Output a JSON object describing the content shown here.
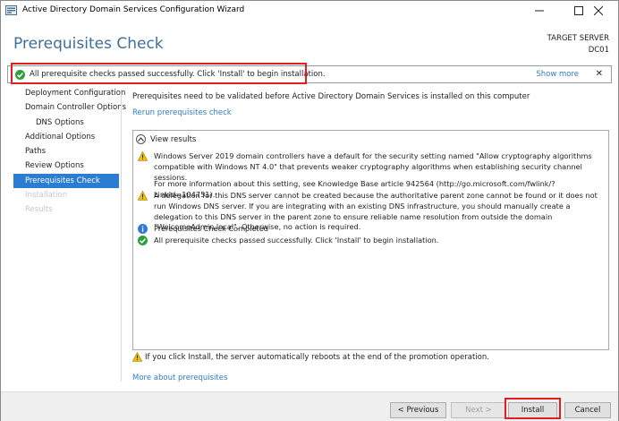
{
  "window": {
    "title": "Active Directory Domain Services Configuration Wizard",
    "controls": [
      "minimize-icon",
      "maximize-icon",
      "close-icon"
    ]
  },
  "header": {
    "title": "Prerequisites Check",
    "target_label": "TARGET SERVER",
    "target_name": "DC01"
  },
  "status": {
    "icon": "success-check-icon",
    "text": "All prerequisite checks passed successfully.  Click 'Install' to begin installation.",
    "show_more": "Show more",
    "close": "✕"
  },
  "sidebar": {
    "items": [
      {
        "label": "Deployment Configuration",
        "state": "normal"
      },
      {
        "label": "Domain Controller Options",
        "state": "normal"
      },
      {
        "label": "DNS Options",
        "state": "normal",
        "sub": true
      },
      {
        "label": "Additional Options",
        "state": "normal"
      },
      {
        "label": "Paths",
        "state": "normal"
      },
      {
        "label": "Review Options",
        "state": "normal"
      },
      {
        "label": "Prerequisites Check",
        "state": "active"
      },
      {
        "label": "Installation",
        "state": "disabled"
      },
      {
        "label": "Results",
        "state": "disabled"
      }
    ]
  },
  "main": {
    "intro": "Prerequisites need to be validated before Active Directory Domain Services is installed on this computer",
    "rerun": "Rerun prerequisites check",
    "view_results": "View results",
    "messages": [
      {
        "icon": "warning-icon",
        "text": "Windows Server 2019 domain controllers have a default for the security setting named \"Allow cryptography algorithms compatible with Windows NT 4.0\" that prevents weaker cryptography algorithms when establishing security channel sessions."
      },
      {
        "icon": "",
        "text": "For more information about this setting, see Knowledge Base article 942564 (http://go.microsoft.com/fwlink/?LinkId=104751)."
      },
      {
        "icon": "warning-icon",
        "text": "A delegation for this DNS server cannot be created because the authoritative parent zone cannot be found or it does not run Windows DNS server. If you are integrating with an existing DNS infrastructure, you should manually create a delegation to this DNS server in the parent zone to ensure reliable name resolution from outside the domain \"WelcomeAdmin.local\". Otherwise, no action is required."
      },
      {
        "icon": "info-icon",
        "text": "Prerequisites Check Completed"
      },
      {
        "icon": "success-check-icon",
        "text": "All prerequisite checks passed successfully.  Click 'Install' to begin installation."
      }
    ],
    "footnote": "If you click Install, the server automatically reboots at the end of the promotion operation.",
    "more_link": "More about prerequisites"
  },
  "footer": {
    "previous": "< Previous",
    "next": "Next >",
    "install": "Install",
    "cancel": "Cancel"
  },
  "colors": {
    "accent": "#2b7cd3",
    "title_blue": "#3f6f96",
    "link": "#2e7dc4",
    "highlight_red": "#e02020",
    "warning": "#f2c200",
    "success": "#2e9e3e",
    "info": "#2b7cd3"
  }
}
